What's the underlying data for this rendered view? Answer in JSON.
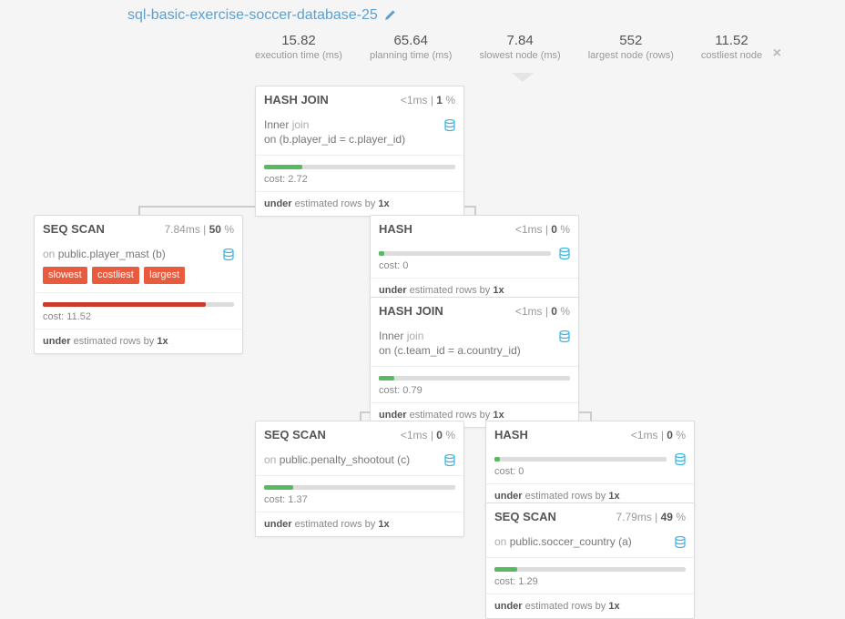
{
  "title": "sql-basic-exercise-soccer-database-25",
  "stats": [
    {
      "value": "15.82",
      "label": "execution time (ms)"
    },
    {
      "value": "65.64",
      "label": "planning time (ms)"
    },
    {
      "value": "7.84",
      "label": "slowest node (ms)"
    },
    {
      "value": "552",
      "label": "largest node (rows)"
    },
    {
      "value": "11.52",
      "label": "costliest node"
    }
  ],
  "nodes": {
    "hashjoin1": {
      "title": "HASH JOIN",
      "ms": "<1ms",
      "pct": "1",
      "sub_prefix": "Inner",
      "sub_grey": "join",
      "cond": "on (b.player_id = c.player_id)",
      "bar_pct": 20,
      "bar_color": "green",
      "cost_label": "cost:",
      "cost_val": "2.72",
      "est_prefix": "under",
      "est_mid": "estimated rows by",
      "est_factor": "1x"
    },
    "seqscan1": {
      "title": "SEQ SCAN",
      "ms": "7.84ms",
      "pct": "50",
      "on_label": "on",
      "on_target": "public.player_mast (b)",
      "badges": [
        "slowest",
        "costliest",
        "largest"
      ],
      "bar_pct": 85,
      "bar_color": "red",
      "cost_label": "cost:",
      "cost_val": "11.52",
      "est_prefix": "under",
      "est_mid": "estimated rows by",
      "est_factor": "1x"
    },
    "hash1": {
      "title": "HASH",
      "ms": "<1ms",
      "pct": "0",
      "bar_pct": 3,
      "bar_color": "green",
      "cost_label": "cost:",
      "cost_val": "0",
      "est_prefix": "under",
      "est_mid": "estimated rows by",
      "est_factor": "1x"
    },
    "hashjoin2": {
      "title": "HASH JOIN",
      "ms": "<1ms",
      "pct": "0",
      "sub_prefix": "Inner",
      "sub_grey": "join",
      "cond": "on (c.team_id = a.country_id)",
      "bar_pct": 8,
      "bar_color": "green",
      "cost_label": "cost:",
      "cost_val": "0.79",
      "est_prefix": "under",
      "est_mid": "estimated rows by",
      "est_factor": "1x"
    },
    "seqscan2": {
      "title": "SEQ SCAN",
      "ms": "<1ms",
      "pct": "0",
      "on_label": "on",
      "on_target": "public.penalty_shootout (c)",
      "bar_pct": 15,
      "bar_color": "green",
      "cost_label": "cost:",
      "cost_val": "1.37",
      "est_prefix": "under",
      "est_mid": "estimated rows by",
      "est_factor": "1x"
    },
    "hash2": {
      "title": "HASH",
      "ms": "<1ms",
      "pct": "0",
      "bar_pct": 3,
      "bar_color": "green",
      "cost_label": "cost:",
      "cost_val": "0",
      "est_prefix": "under",
      "est_mid": "estimated rows by",
      "est_factor": "1x"
    },
    "seqscan3": {
      "title": "SEQ SCAN",
      "ms": "7.79ms",
      "pct": "49",
      "on_label": "on",
      "on_target": "public.soccer_country (a)",
      "bar_pct": 12,
      "bar_color": "green",
      "cost_label": "cost:",
      "cost_val": "1.29",
      "est_prefix": "under",
      "est_mid": "estimated rows by",
      "est_factor": "1x"
    }
  }
}
